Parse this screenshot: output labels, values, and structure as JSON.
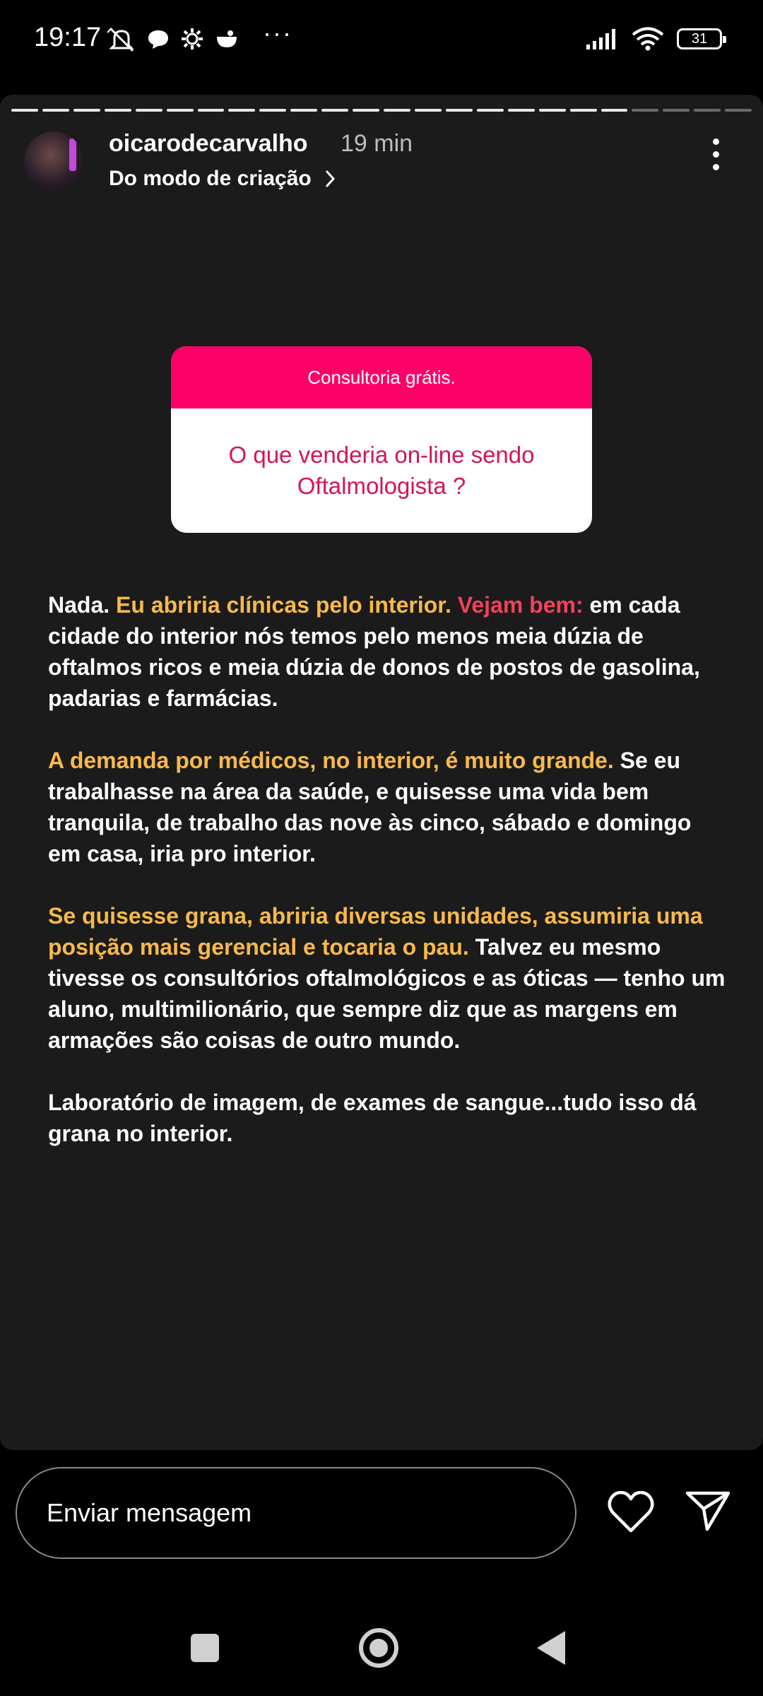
{
  "status_bar": {
    "time": "19:17",
    "battery": "31",
    "icons": [
      "notifications-off-icon",
      "chat-bubble-icon",
      "settings-gear-icon",
      "app-icon",
      "more-notifications-icon",
      "signal-icon",
      "wifi-icon",
      "battery-icon"
    ]
  },
  "story": {
    "progress": {
      "total_segments": 24,
      "viewed_segments": 20
    },
    "username": "oicarodecarvalho",
    "time_ago": "19 min",
    "subtitle": "Do modo de criação",
    "question_sticker": {
      "header": "Consultoria grátis.",
      "question": "O que venderia on-line sendo Oftalmologista ?",
      "colors": {
        "header_bg": "#ff0068",
        "question_text": "#d4145a"
      }
    },
    "paragraphs": [
      [
        {
          "text": "Nada. ",
          "style": "white"
        },
        {
          "text": "Eu abriria clínicas pelo interior. ",
          "style": "yellow"
        },
        {
          "text": "Vejam bem: ",
          "style": "red"
        },
        {
          "text": "em cada cidade do interior nós temos pelo menos meia dúzia de oftalmos ricos e meia dúzia de donos de postos de gasolina, padarias e farmácias.",
          "style": "white"
        }
      ],
      [
        {
          "text": "A demanda por médicos, no interior, é muito grande. ",
          "style": "yellow"
        },
        {
          "text": "Se eu trabalhasse na área da saúde, e quisesse uma vida bem tranquila, de trabalho das nove às cinco, sábado e domingo em casa, iria pro interior.",
          "style": "white"
        }
      ],
      [
        {
          "text": "Se quisesse grana, abriria diversas unidades, assumiria uma posição mais gerencial e tocaria o pau. ",
          "style": "yellow"
        },
        {
          "text": "Talvez eu mesmo tivesse os consultórios oftalmológicos e as óticas — tenho um aluno, multimilionário, que sempre diz que as margens em armações são coisas de outro mundo.",
          "style": "white"
        }
      ],
      [
        {
          "text": "Laboratório de imagem, de exames de sangue...tudo isso dá grana no interior.",
          "style": "white"
        }
      ]
    ],
    "colors": {
      "yellow": "#f7b94c",
      "red": "#f2415a",
      "background": "#1b1b1b"
    }
  },
  "reply_bar": {
    "placeholder": "Enviar mensagem",
    "like_icon": "heart-icon",
    "share_icon": "send-icon"
  },
  "nav_bar": {
    "icons": [
      "recents-square-icon",
      "home-circle-icon",
      "back-triangle-icon"
    ]
  }
}
